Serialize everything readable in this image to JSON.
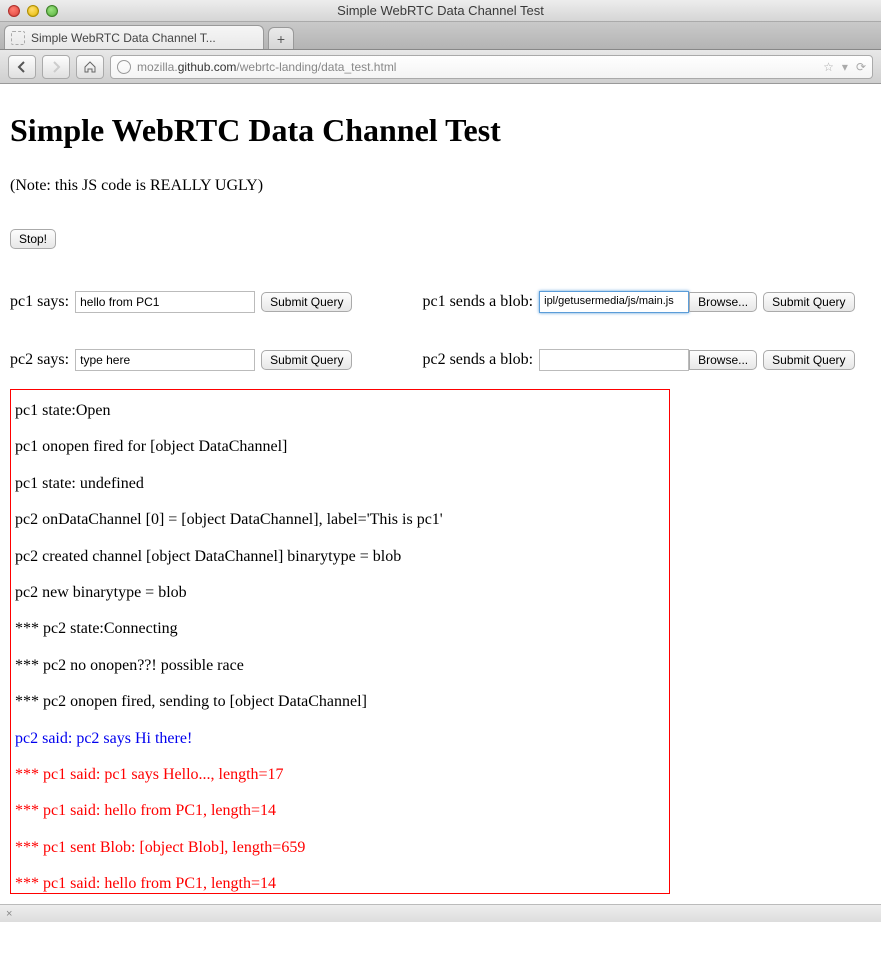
{
  "window": {
    "title": "Simple WebRTC Data Channel Test"
  },
  "tab": {
    "label": "Simple WebRTC Data Channel T...",
    "new_tab_glyph": "+"
  },
  "url": {
    "prefix": "mozilla.",
    "domain": "github.com",
    "path": "/webrtc-landing/data_test.html"
  },
  "page": {
    "heading": "Simple WebRTC Data Channel Test",
    "note": "(Note: this JS code is REALLY UGLY)",
    "stop_label": "Stop!",
    "pc1_says_label": "pc1 says:",
    "pc1_says_value": "hello from PC1",
    "pc2_says_label": "pc2 says:",
    "pc2_says_value": "type here",
    "pc1_blob_label": "pc1 sends a blob:",
    "pc1_blob_file": "ipl/getusermedia/js/main.js",
    "pc2_blob_label": "pc2 sends a blob:",
    "pc2_blob_file": "",
    "browse_label": "Browse...",
    "submit_label": "Submit Query"
  },
  "log": [
    {
      "text": "pc1 state:Open",
      "cls": ""
    },
    {
      "text": "pc1 onopen fired for [object DataChannel]",
      "cls": ""
    },
    {
      "text": "pc1 state: undefined",
      "cls": ""
    },
    {
      "text": "pc2 onDataChannel [0] = [object DataChannel], label='This is pc1'",
      "cls": ""
    },
    {
      "text": "pc2 created channel [object DataChannel] binarytype = blob",
      "cls": ""
    },
    {
      "text": "pc2 new binarytype = blob",
      "cls": ""
    },
    {
      "text": "*** pc2 state:Connecting",
      "cls": ""
    },
    {
      "text": "*** pc2 no onopen??! possible race",
      "cls": ""
    },
    {
      "text": "*** pc2 onopen fired, sending to [object DataChannel]",
      "cls": ""
    },
    {
      "text": "pc2 said: pc2 says Hi there!",
      "cls": "log-blue"
    },
    {
      "text": "*** pc1 said: pc1 says Hello..., length=17",
      "cls": "log-red"
    },
    {
      "text": "*** pc1 said: hello from PC1, length=14",
      "cls": "log-red"
    },
    {
      "text": "*** pc1 sent Blob: [object Blob], length=659",
      "cls": "log-red"
    },
    {
      "text": "*** pc1 said: hello from PC1, length=14",
      "cls": "log-red"
    }
  ],
  "status": {
    "close_glyph": "×"
  }
}
